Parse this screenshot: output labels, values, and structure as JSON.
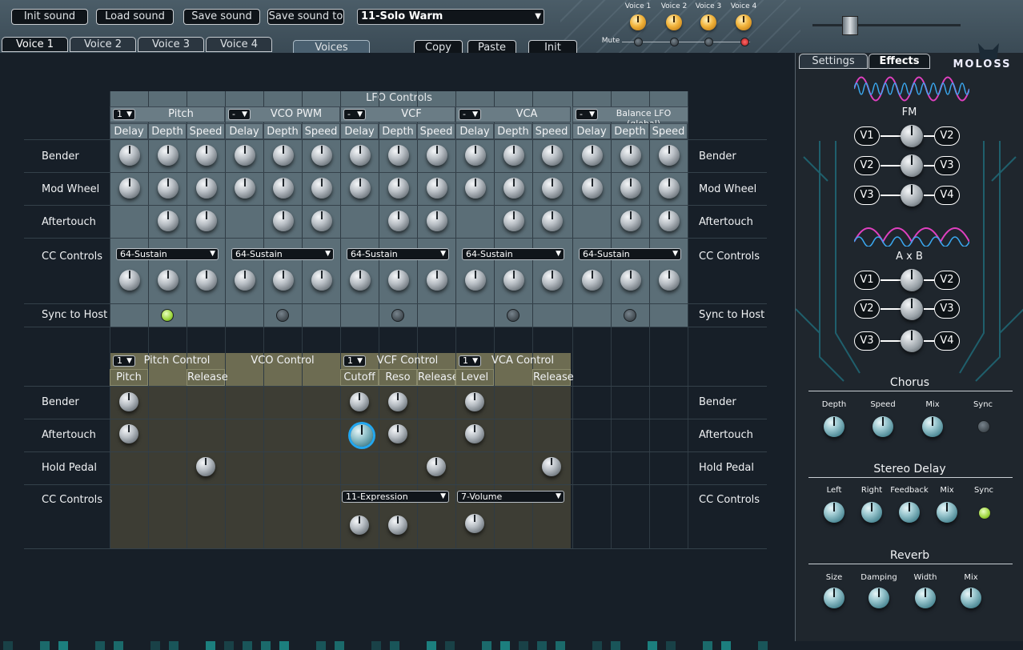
{
  "toolbar": {
    "init": "Init sound",
    "load": "Load sound",
    "save": "Save sound",
    "save_to": "Save sound to",
    "preset": "11-Solo Warm"
  },
  "voice_tabs": [
    "Voice 1",
    "Voice 2",
    "Voice 3",
    "Voice 4"
  ],
  "actions": {
    "voices": "Voices",
    "copy": "Copy",
    "paste": "Paste",
    "init": "Init"
  },
  "voice_knobs": {
    "labels": [
      "Voice 1",
      "Voice 2",
      "Voice 3",
      "Voice 4"
    ],
    "mute": "Mute"
  },
  "right_tabs": {
    "settings": "Settings",
    "effects": "Effects",
    "logo": "MOLOSS"
  },
  "lfo": {
    "title": "LFO Controls",
    "groups": [
      {
        "sel": "1",
        "name": "Pitch"
      },
      {
        "sel": "-",
        "name": "VCO PWM"
      },
      {
        "sel": "-",
        "name": "VCF"
      },
      {
        "sel": "-",
        "name": "VCA"
      },
      {
        "sel": "-",
        "name": "Balance LFO (global)"
      }
    ],
    "sub": [
      "Delay",
      "Depth",
      "Speed"
    ],
    "rows": [
      "Bender",
      "Mod Wheel",
      "Aftertouch",
      "CC Controls",
      "Sync to Host"
    ],
    "cc": "64-Sustain"
  },
  "ctrl": {
    "groups": [
      {
        "sel": "1",
        "name": "Pitch Control"
      },
      {
        "name": "VCO Control"
      },
      {
        "sel": "1",
        "name": "VCF Control"
      },
      {
        "sel": "1",
        "name": "VCA Control"
      }
    ],
    "sub": [
      "Pitch",
      "",
      "Release",
      "",
      "",
      "",
      "Cutoff",
      "Reso",
      "Release",
      "Level",
      "",
      "Release"
    ],
    "rows": [
      "Bender",
      "Aftertouch",
      "Hold Pedal",
      "CC Controls"
    ],
    "cc_vcf": "11-Expression",
    "cc_vca": "7-Volume"
  },
  "fx": {
    "fm": "FM",
    "axb": "A x B",
    "fm_rows": [
      [
        "V1",
        "V2"
      ],
      [
        "V2",
        "V3"
      ],
      [
        "V3",
        "V4"
      ]
    ],
    "axb_rows": [
      [
        "V1",
        "V2"
      ],
      [
        "V2",
        "V3"
      ],
      [
        "V3",
        "V4"
      ]
    ],
    "chorus": {
      "title": "Chorus",
      "labels": [
        "Depth",
        "Speed",
        "Mix",
        "Sync"
      ]
    },
    "delay": {
      "title": "Stereo Delay",
      "labels": [
        "Left",
        "Right",
        "Feedback",
        "Mix",
        "Sync"
      ]
    },
    "reverb": {
      "title": "Reverb",
      "labels": [
        "Size",
        "Damping",
        "Width",
        "Mix"
      ]
    }
  }
}
